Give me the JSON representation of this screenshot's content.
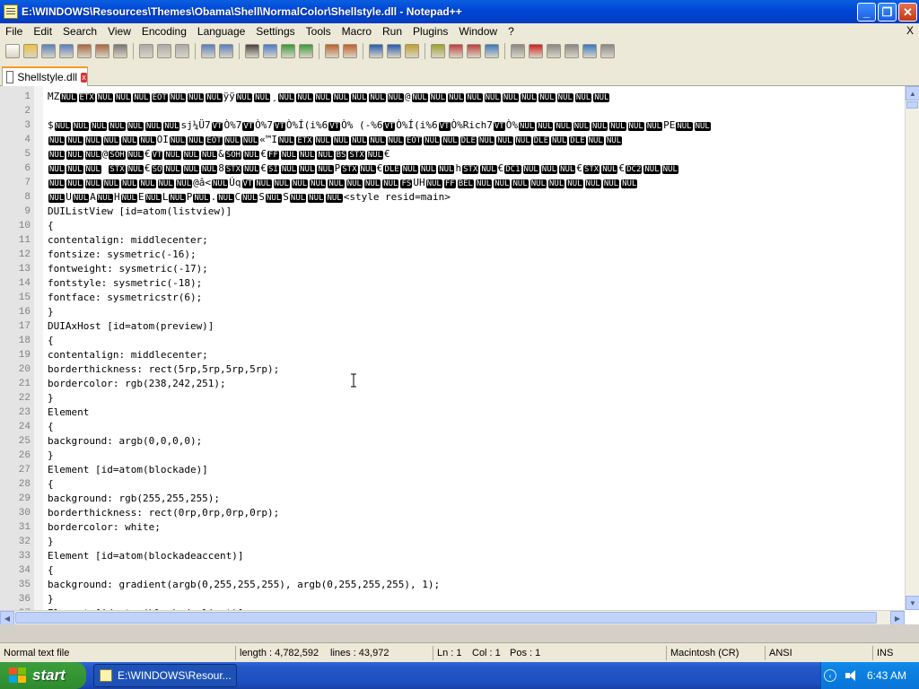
{
  "window": {
    "title": "E:\\WINDOWS\\Resources\\Themes\\Obama\\Shell\\NormalColor\\Shellstyle.dll - Notepad++",
    "minimize_label": "_",
    "maximize_label": "❐",
    "close_label": "✕"
  },
  "menubar": {
    "items": [
      "File",
      "Edit",
      "Search",
      "View",
      "Encoding",
      "Language",
      "Settings",
      "Tools",
      "Macro",
      "Run",
      "Plugins",
      "Window",
      "?"
    ],
    "close_label": "X"
  },
  "toolbar": {
    "icons": [
      "new-icon",
      "open-icon",
      "save-icon",
      "save-all-icon",
      "close-icon",
      "close-all-icon",
      "print-icon",
      "cut-icon",
      "copy-icon",
      "paste-icon",
      "undo-icon",
      "redo-icon",
      "find-icon",
      "replace-icon",
      "zoom-in-icon",
      "zoom-out-icon",
      "sync-v-icon",
      "sync-h-icon",
      "wrap-icon",
      "all-chars-icon",
      "indent-guide-icon",
      "udl-icon",
      "map-icon",
      "function-list-icon",
      "folder-workspace-icon",
      "monitor-icon",
      "record-macro-icon",
      "stop-record-icon",
      "play-macro-icon",
      "run-macro-multiple-icon",
      "save-macro-icon"
    ]
  },
  "tab": {
    "label": "Shellstyle.dll",
    "close_label": "x"
  },
  "editor": {
    "lines": [
      {
        "n": "1",
        "segs": [
          [
            "t",
            "MZ"
          ],
          [
            "c",
            "NUL"
          ],
          [
            "c",
            "ETX"
          ],
          [
            "c",
            "NUL"
          ],
          [
            "c",
            "NUL"
          ],
          [
            "c",
            "NUL"
          ],
          [
            "c",
            "EOT"
          ],
          [
            "c",
            "NUL"
          ],
          [
            "c",
            "NUL"
          ],
          [
            "c",
            "NUL"
          ],
          [
            "t",
            "ÿÿ"
          ],
          [
            "c",
            "NUL"
          ],
          [
            "c",
            "NUL"
          ],
          [
            "t",
            "¸"
          ],
          [
            "c",
            "NUL"
          ],
          [
            "c",
            "NUL"
          ],
          [
            "c",
            "NUL"
          ],
          [
            "c",
            "NUL"
          ],
          [
            "c",
            "NUL"
          ],
          [
            "c",
            "NUL"
          ],
          [
            "c",
            "NUL"
          ],
          [
            "t",
            "@"
          ],
          [
            "c",
            "NUL"
          ],
          [
            "c",
            "NUL"
          ],
          [
            "c",
            "NUL"
          ],
          [
            "c",
            "NUL"
          ],
          [
            "c",
            "NUL"
          ],
          [
            "c",
            "NUL"
          ],
          [
            "c",
            "NUL"
          ],
          [
            "c",
            "NUL"
          ],
          [
            "c",
            "NUL"
          ],
          [
            "c",
            "NUL"
          ],
          [
            "c",
            "NUL"
          ]
        ]
      },
      {
        "n": "2",
        "segs": []
      },
      {
        "n": "3",
        "segs": [
          [
            "t",
            "$"
          ],
          [
            "c",
            "NUL"
          ],
          [
            "c",
            "NUL"
          ],
          [
            "c",
            "NUL"
          ],
          [
            "c",
            "NUL"
          ],
          [
            "c",
            "NUL"
          ],
          [
            "c",
            "NUL"
          ],
          [
            "c",
            "NUL"
          ],
          [
            "t",
            "sj¼Ü7"
          ],
          [
            "c",
            "VT"
          ],
          [
            "t",
            "Ò%7"
          ],
          [
            "c",
            "VT"
          ],
          [
            "t",
            "Ò%7"
          ],
          [
            "c",
            "VT"
          ],
          [
            "t",
            "Ò%Í(i%6"
          ],
          [
            "c",
            "VT"
          ],
          [
            "t",
            "Ò% (-%6"
          ],
          [
            "c",
            "VT"
          ],
          [
            "t",
            "Ò%Í(i%6"
          ],
          [
            "c",
            "VT"
          ],
          [
            "t",
            "Ò%Rich7"
          ],
          [
            "c",
            "VT"
          ],
          [
            "t",
            "Ò%"
          ],
          [
            "c",
            "NUL"
          ],
          [
            "c",
            "NUL"
          ],
          [
            "c",
            "NUL"
          ],
          [
            "c",
            "NUL"
          ],
          [
            "c",
            "NUL"
          ],
          [
            "c",
            "NUL"
          ],
          [
            "c",
            "NUL"
          ],
          [
            "c",
            "NUL"
          ],
          [
            "t",
            "PE"
          ],
          [
            "c",
            "NUL"
          ],
          [
            "c",
            "NUL"
          ]
        ]
      },
      {
        "n": "4",
        "segs": [
          [
            "c",
            "NUL"
          ],
          [
            "c",
            "NUL"
          ],
          [
            "c",
            "NUL"
          ],
          [
            "c",
            "NUL"
          ],
          [
            "c",
            "NUL"
          ],
          [
            "c",
            "NUL"
          ],
          [
            "t",
            "OI"
          ],
          [
            "c",
            "NUL"
          ],
          [
            "c",
            "NUL"
          ],
          [
            "c",
            "EOT"
          ],
          [
            "c",
            "NUL"
          ],
          [
            "c",
            "NUL"
          ],
          [
            "t",
            "«™I"
          ],
          [
            "c",
            "NUL"
          ],
          [
            "c",
            "ETX"
          ],
          [
            "c",
            "NUL"
          ],
          [
            "c",
            "NUL"
          ],
          [
            "c",
            "NUL"
          ],
          [
            "c",
            "NUL"
          ],
          [
            "c",
            "NUL"
          ],
          [
            "c",
            "EOT"
          ],
          [
            "c",
            "NUL"
          ],
          [
            "c",
            "NUL"
          ],
          [
            "c",
            "DLE"
          ],
          [
            "c",
            "NUL"
          ],
          [
            "c",
            "NUL"
          ],
          [
            "c",
            "NUL"
          ],
          [
            "c",
            "DLE"
          ],
          [
            "c",
            "NUL"
          ],
          [
            "c",
            "DLE"
          ],
          [
            "c",
            "NUL"
          ],
          [
            "c",
            "NUL"
          ]
        ]
      },
      {
        "n": "5",
        "segs": [
          [
            "c",
            "NUL"
          ],
          [
            "c",
            "NUL"
          ],
          [
            "c",
            "NUL"
          ],
          [
            "t",
            "@"
          ],
          [
            "c",
            "SOH"
          ],
          [
            "c",
            "NUL"
          ],
          [
            "t",
            "€"
          ],
          [
            "c",
            "VT"
          ],
          [
            "c",
            "NUL"
          ],
          [
            "c",
            "NUL"
          ],
          [
            "c",
            "NUL"
          ],
          [
            "t",
            "&"
          ],
          [
            "c",
            "SOH"
          ],
          [
            "c",
            "NUL"
          ],
          [
            "t",
            "€"
          ],
          [
            "c",
            "FF"
          ],
          [
            "c",
            "NUL"
          ],
          [
            "c",
            "NUL"
          ],
          [
            "c",
            "NUL"
          ],
          [
            "c",
            "BS"
          ],
          [
            "c",
            "STX"
          ],
          [
            "c",
            "NUL"
          ],
          [
            "t",
            "€"
          ]
        ]
      },
      {
        "n": "6",
        "segs": [
          [
            "c",
            "NUL"
          ],
          [
            "c",
            "NUL"
          ],
          [
            "c",
            "NUL"
          ],
          [
            "t",
            " "
          ],
          [
            "c",
            "STX"
          ],
          [
            "c",
            "NUL"
          ],
          [
            "t",
            "€"
          ],
          [
            "c",
            "SO"
          ],
          [
            "c",
            "NUL"
          ],
          [
            "c",
            "NUL"
          ],
          [
            "c",
            "NUL"
          ],
          [
            "t",
            "8"
          ],
          [
            "c",
            "STX"
          ],
          [
            "c",
            "NUL"
          ],
          [
            "t",
            "€"
          ],
          [
            "c",
            "SI"
          ],
          [
            "c",
            "NUL"
          ],
          [
            "c",
            "NUL"
          ],
          [
            "c",
            "NUL"
          ],
          [
            "t",
            "P"
          ],
          [
            "c",
            "STX"
          ],
          [
            "c",
            "NUL"
          ],
          [
            "t",
            "€"
          ],
          [
            "c",
            "DLE"
          ],
          [
            "c",
            "NUL"
          ],
          [
            "c",
            "NUL"
          ],
          [
            "c",
            "NUL"
          ],
          [
            "t",
            "h"
          ],
          [
            "c",
            "STX"
          ],
          [
            "c",
            "NUL"
          ],
          [
            "t",
            "€"
          ],
          [
            "c",
            "DC1"
          ],
          [
            "c",
            "NUL"
          ],
          [
            "c",
            "NUL"
          ],
          [
            "c",
            "NUL"
          ],
          [
            "t",
            "€"
          ],
          [
            "c",
            "STX"
          ],
          [
            "c",
            "NUL"
          ],
          [
            "t",
            "€"
          ],
          [
            "c",
            "DC2"
          ],
          [
            "c",
            "NUL"
          ],
          [
            "c",
            "NUL"
          ]
        ]
      },
      {
        "n": "7",
        "segs": [
          [
            "c",
            "NUL"
          ],
          [
            "c",
            "NUL"
          ],
          [
            "c",
            "NUL"
          ],
          [
            "c",
            "NUL"
          ],
          [
            "c",
            "NUL"
          ],
          [
            "c",
            "NUL"
          ],
          [
            "c",
            "NUL"
          ],
          [
            "c",
            "NUL"
          ],
          [
            "t",
            "@â<"
          ],
          [
            "c",
            "NUL"
          ],
          [
            "t",
            "Úq"
          ],
          [
            "c",
            "VT"
          ],
          [
            "c",
            "NUL"
          ],
          [
            "c",
            "NUL"
          ],
          [
            "c",
            "NUL"
          ],
          [
            "c",
            "NUL"
          ],
          [
            "c",
            "NUL"
          ],
          [
            "c",
            "NUL"
          ],
          [
            "c",
            "NUL"
          ],
          [
            "c",
            "NUL"
          ],
          [
            "c",
            "FS"
          ],
          [
            "t",
            "UH"
          ],
          [
            "c",
            "NUL"
          ],
          [
            "c",
            "FF"
          ],
          [
            "c",
            "BEL"
          ],
          [
            "c",
            "NUL"
          ],
          [
            "c",
            "NUL"
          ],
          [
            "c",
            "NUL"
          ],
          [
            "c",
            "NUL"
          ],
          [
            "c",
            "NUL"
          ],
          [
            "c",
            "NUL"
          ],
          [
            "c",
            "NUL"
          ],
          [
            "c",
            "NUL"
          ],
          [
            "c",
            "NUL"
          ]
        ]
      },
      {
        "n": "8",
        "segs": [
          [
            "c",
            "NUL"
          ],
          [
            "t",
            "U"
          ],
          [
            "c",
            "NUL"
          ],
          [
            "t",
            "A"
          ],
          [
            "c",
            "NUL"
          ],
          [
            "t",
            "H"
          ],
          [
            "c",
            "NUL"
          ],
          [
            "t",
            "E"
          ],
          [
            "c",
            "NUL"
          ],
          [
            "t",
            "L"
          ],
          [
            "c",
            "NUL"
          ],
          [
            "t",
            "P"
          ],
          [
            "c",
            "NUL"
          ],
          [
            "t",
            "."
          ],
          [
            "c",
            "NUL"
          ],
          [
            "t",
            "C"
          ],
          [
            "c",
            "NUL"
          ],
          [
            "t",
            "S"
          ],
          [
            "c",
            "NUL"
          ],
          [
            "t",
            "S"
          ],
          [
            "c",
            "NUL"
          ],
          [
            "c",
            "NUL"
          ],
          [
            "c",
            "NUL"
          ],
          [
            "t",
            "<style resid=main>"
          ]
        ]
      },
      {
        "n": "9",
        "segs": [
          [
            "t",
            "DUIListView [id=atom(listview)]"
          ]
        ]
      },
      {
        "n": "10",
        "segs": [
          [
            "t",
            "{"
          ]
        ]
      },
      {
        "n": "11",
        "segs": [
          [
            "t",
            "contentalign: middlecenter;"
          ]
        ]
      },
      {
        "n": "12",
        "segs": [
          [
            "t",
            "fontsize: sysmetric(-16);"
          ]
        ]
      },
      {
        "n": "13",
        "segs": [
          [
            "t",
            "fontweight: sysmetric(-17);"
          ]
        ]
      },
      {
        "n": "14",
        "segs": [
          [
            "t",
            "fontstyle: sysmetric(-18);"
          ]
        ]
      },
      {
        "n": "15",
        "segs": [
          [
            "t",
            "fontface: sysmetricstr(6);"
          ]
        ]
      },
      {
        "n": "16",
        "segs": [
          [
            "t",
            "}"
          ]
        ]
      },
      {
        "n": "17",
        "segs": [
          [
            "t",
            "DUIAxHost [id=atom(preview)]"
          ]
        ]
      },
      {
        "n": "18",
        "segs": [
          [
            "t",
            "{"
          ]
        ]
      },
      {
        "n": "19",
        "segs": [
          [
            "t",
            "contentalign: middlecenter;"
          ]
        ]
      },
      {
        "n": "20",
        "segs": [
          [
            "t",
            "borderthickness: rect(5rp,5rp,5rp,5rp);"
          ]
        ]
      },
      {
        "n": "21",
        "segs": [
          [
            "t",
            "bordercolor: rgb(238,242,251);"
          ]
        ]
      },
      {
        "n": "22",
        "segs": [
          [
            "t",
            "}"
          ]
        ]
      },
      {
        "n": "23",
        "segs": [
          [
            "t",
            "Element"
          ]
        ]
      },
      {
        "n": "24",
        "segs": [
          [
            "t",
            "{"
          ]
        ]
      },
      {
        "n": "25",
        "segs": [
          [
            "t",
            "background: argb(0,0,0,0);"
          ]
        ]
      },
      {
        "n": "26",
        "segs": [
          [
            "t",
            "}"
          ]
        ]
      },
      {
        "n": "27",
        "segs": [
          [
            "t",
            "Element [id=atom(blockade)]"
          ]
        ]
      },
      {
        "n": "28",
        "segs": [
          [
            "t",
            "{"
          ]
        ]
      },
      {
        "n": "29",
        "segs": [
          [
            "t",
            "background: rgb(255,255,255);"
          ]
        ]
      },
      {
        "n": "30",
        "segs": [
          [
            "t",
            "borderthickness: rect(0rp,0rp,0rp,0rp);"
          ]
        ]
      },
      {
        "n": "31",
        "segs": [
          [
            "t",
            "bordercolor: white;"
          ]
        ]
      },
      {
        "n": "32",
        "segs": [
          [
            "t",
            "}"
          ]
        ]
      },
      {
        "n": "33",
        "segs": [
          [
            "t",
            "Element [id=atom(blockadeaccent)]"
          ]
        ]
      },
      {
        "n": "34",
        "segs": [
          [
            "t",
            "{"
          ]
        ]
      },
      {
        "n": "35",
        "segs": [
          [
            "t",
            "background: gradient(argb(0,255,255,255), argb(0,255,255,255), 1);"
          ]
        ]
      },
      {
        "n": "36",
        "segs": [
          [
            "t",
            "}"
          ]
        ]
      },
      {
        "n": "37",
        "segs": [
          [
            "t",
            "Element [id=atom(blockadeclient)]"
          ]
        ]
      }
    ]
  },
  "statusbar": {
    "file_type": "Normal text file",
    "length": "length : 4,782,592",
    "lines": "lines : 43,972",
    "ln": "Ln : 1",
    "col": "Col : 1",
    "pos": "Pos : 1",
    "eol": "Macintosh (CR)",
    "encoding": "ANSI",
    "mode": "INS"
  },
  "taskbar": {
    "start_label": "start",
    "task_label": "E:\\WINDOWS\\Resour...",
    "clock": "6:43 AM"
  },
  "colors": {
    "title_blue": "#0046d5",
    "control_char_bg": "#000000",
    "start_green": "#379a37"
  }
}
